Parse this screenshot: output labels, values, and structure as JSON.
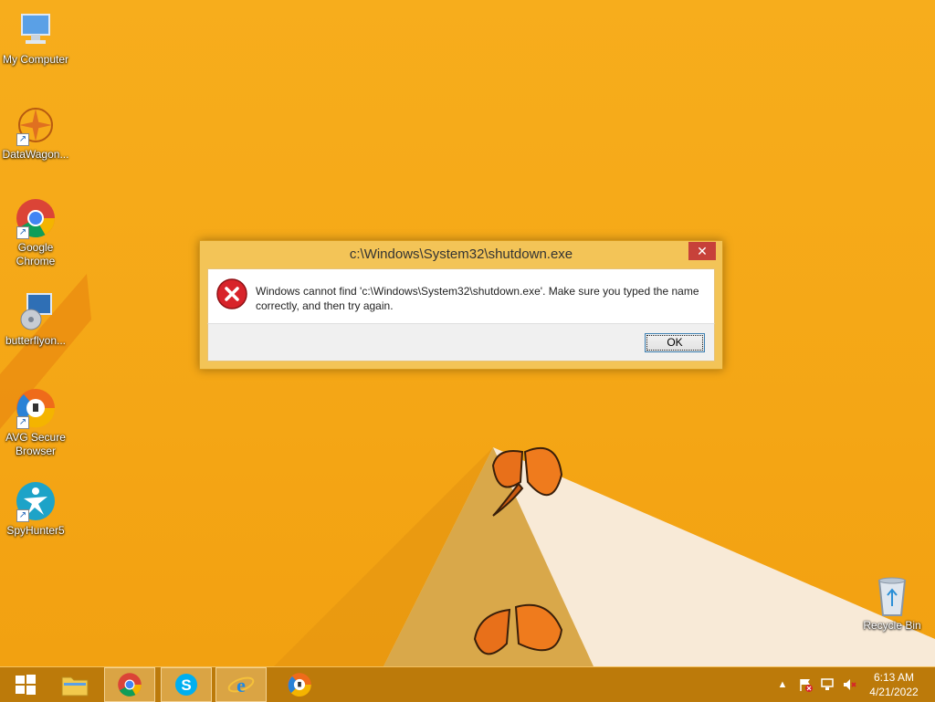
{
  "desktop": {
    "icons": [
      {
        "label": "My Computer",
        "icon": "computer-icon"
      },
      {
        "label": "DataWagon...",
        "icon": "datawagon-icon"
      },
      {
        "label": "Google Chrome",
        "icon": "chrome-icon"
      },
      {
        "label": "butterflyon...",
        "icon": "installer-icon"
      },
      {
        "label": "AVG Secure Browser",
        "icon": "avg-browser-icon"
      },
      {
        "label": "SpyHunter5",
        "icon": "spyhunter-icon"
      }
    ],
    "recycle_bin": {
      "label": "Recycle Bin",
      "icon": "recycle-bin-icon"
    }
  },
  "dialog": {
    "title": "c:\\Windows\\System32\\shutdown.exe",
    "close_label": "✕",
    "message": "Windows cannot find 'c:\\Windows\\System32\\shutdown.exe'. Make sure you typed the name correctly, and then try again.",
    "ok_label": "OK",
    "icon": "error-icon"
  },
  "taskbar": {
    "items": [
      {
        "name": "start-button",
        "icon": "windows-logo-icon"
      },
      {
        "name": "file-explorer",
        "icon": "folder-icon"
      },
      {
        "name": "chrome",
        "icon": "chrome-icon"
      },
      {
        "name": "skype",
        "icon": "skype-icon"
      },
      {
        "name": "internet-explorer",
        "icon": "ie-icon"
      },
      {
        "name": "avg-browser",
        "icon": "avg-browser-icon"
      }
    ],
    "tray": {
      "show_hidden": "▲",
      "time": "6:13 AM",
      "date": "4/21/2022"
    }
  },
  "colors": {
    "wallpaper": "#f5a817",
    "taskbar": "#b7760a",
    "close_button": "#c7413a",
    "error_red": "#d8232a"
  }
}
